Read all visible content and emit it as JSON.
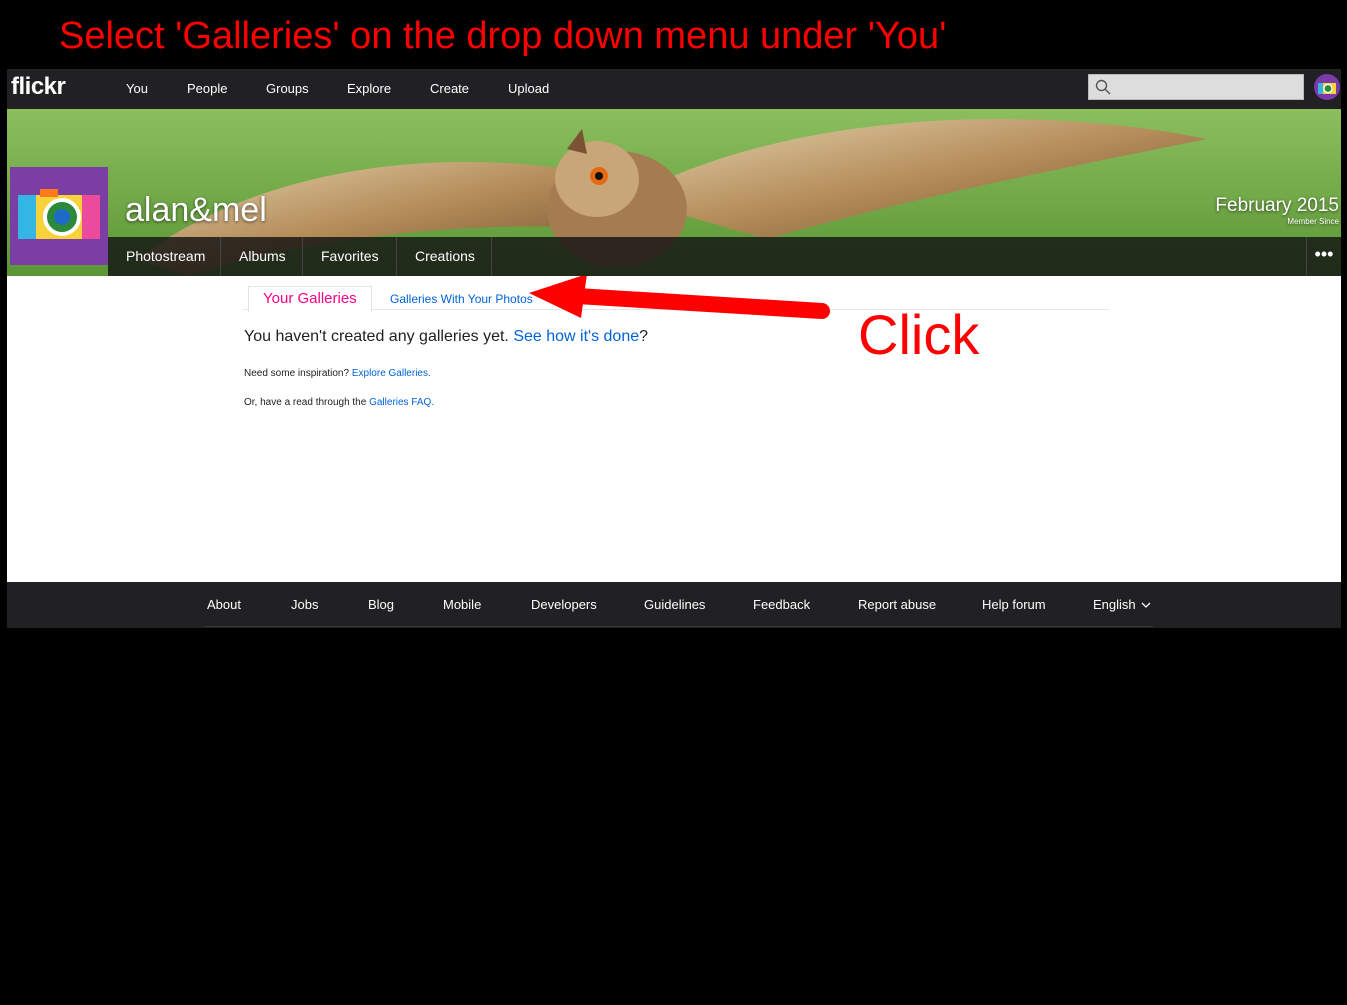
{
  "instruction": "Select 'Galleries' on the drop down menu under 'You'",
  "topnav": {
    "logo": "flickr",
    "links": [
      "You",
      "People",
      "Groups",
      "Explore",
      "Create",
      "Upload"
    ],
    "search_placeholder": ""
  },
  "profile": {
    "username": "alan&mel",
    "member_since_date": "February 2015",
    "member_since_label": "Member Since",
    "subnav": [
      "Photostream",
      "Albums",
      "Favorites",
      "Creations"
    ],
    "more": "•••"
  },
  "galleries": {
    "tab_active": "Your Galleries",
    "tab_other": "Galleries With Your Photos",
    "empty_text": "You haven't created any galleries yet. ",
    "empty_link": "See how it's done",
    "empty_end": "?",
    "inspiration_text": "Need some inspiration? ",
    "inspiration_link": "Explore Galleries",
    "inspiration_end": ".",
    "faq_text": "Or, have a read through the ",
    "faq_link": "Galleries FAQ",
    "faq_end": "."
  },
  "annotation": {
    "click_label": "Click",
    "color": "#ff0000"
  },
  "footer": {
    "links": [
      "About",
      "Jobs",
      "Blog",
      "Mobile",
      "Developers",
      "Guidelines",
      "Feedback",
      "Report abuse",
      "Help forum"
    ],
    "language": "English"
  },
  "colors": {
    "flickr_pink": "#ff0084",
    "flickr_blue": "#0063dc",
    "dark_bar": "#212124",
    "buddy_purple": "#7b3fa4"
  }
}
